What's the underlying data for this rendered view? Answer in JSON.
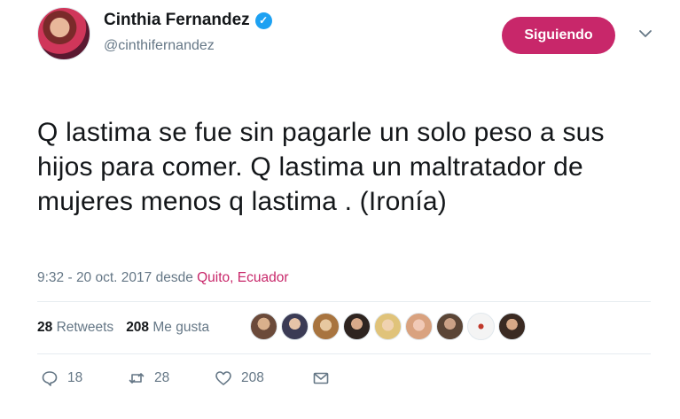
{
  "user": {
    "display_name": "Cinthia Fernandez",
    "handle": "@cinthifernandez",
    "verified_mark": "✓"
  },
  "follow_button_label": "Siguiendo",
  "tweet": {
    "text": "Q lastima se fue sin pagarle un solo peso a sus hijos para comer. Q lastima un maltratador de mujeres menos q lastima . (Ironía)",
    "time": "9:32 - 20 oct. 2017",
    "from_label": "desde",
    "location": "Quito, Ecuador"
  },
  "stats": {
    "retweets_count": "28",
    "retweets_label": "Retweets",
    "likes_count": "208",
    "likes_label": "Me gusta"
  },
  "actions": {
    "reply_count": "18",
    "retweet_count": "28",
    "like_count": "208"
  },
  "colors": {
    "accent": "#c8276a",
    "verified": "#1da1f2",
    "muted_text": "#657786"
  },
  "icons": [
    "verified-icon",
    "chevron-down-icon",
    "reply-icon",
    "retweet-icon",
    "heart-icon",
    "envelope-icon"
  ]
}
